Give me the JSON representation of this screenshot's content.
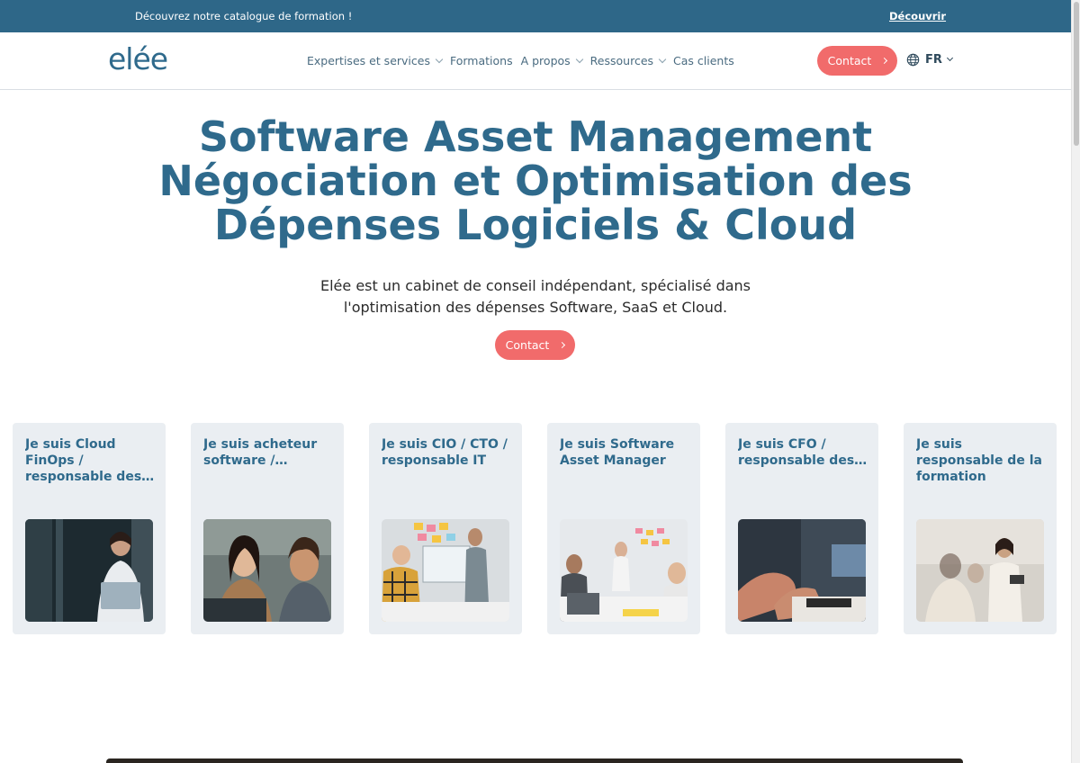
{
  "banner": {
    "text": "Découvrez notre catalogue de formation !",
    "link": "Découvrir"
  },
  "header": {
    "logo": "elée",
    "nav": [
      {
        "label": "Expertises et services",
        "dropdown": true
      },
      {
        "label": "Formations",
        "dropdown": false
      },
      {
        "label": "A propos",
        "dropdown": true
      },
      {
        "label": "Ressources",
        "dropdown": true
      },
      {
        "label": "Cas clients",
        "dropdown": false
      }
    ],
    "contact_label": "Contact",
    "language": "FR"
  },
  "hero": {
    "title_lines": [
      "Software Asset Management",
      "Négociation et Optimisation des",
      "Dépenses Logiciels & Cloud"
    ],
    "subtitle_lines": [
      "Elée est un cabinet de conseil indépendant, spécialisé dans",
      "l'optimisation des dépenses Software, SaaS et Cloud."
    ],
    "contact_label": "Contact"
  },
  "cards": [
    {
      "title": "Je suis Cloud FinOps / responsable des…"
    },
    {
      "title": "Je suis acheteur software /…"
    },
    {
      "title": "Je suis CIO / CTO / responsable IT"
    },
    {
      "title": "Je suis Software Asset Manager"
    },
    {
      "title": "Je suis CFO / responsable des…"
    },
    {
      "title": "Je suis responsable de la formation"
    }
  ],
  "colors": {
    "banner": "#2e6788",
    "primary": "#2f6a8c",
    "accent": "#f16b6b",
    "card_bg": "#eaeef2"
  }
}
